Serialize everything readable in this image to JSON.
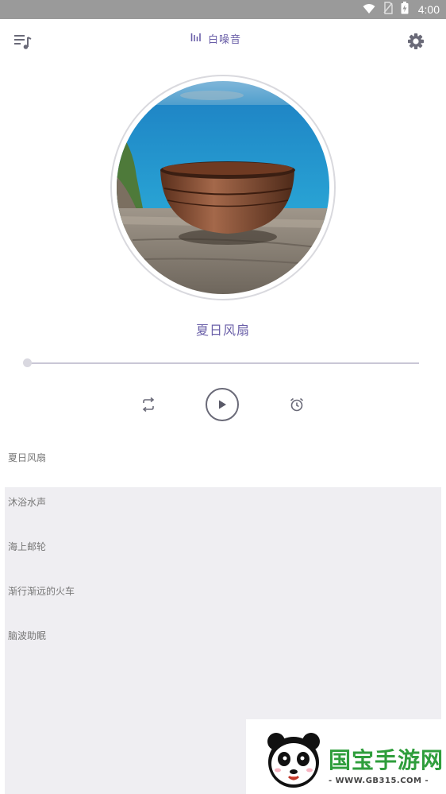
{
  "status_bar": {
    "time": "4:00"
  },
  "toolbar": {
    "title": "白噪音"
  },
  "now_playing": {
    "title": "夏日风扇",
    "progress": 0.0
  },
  "playlist": {
    "items": [
      {
        "label": "夏日风扇"
      },
      {
        "label": "沐浴水声"
      },
      {
        "label": "海上邮轮"
      },
      {
        "label": "渐行渐远的火车"
      },
      {
        "label": "脑波助眠"
      }
    ]
  },
  "watermark": {
    "title": "国宝手游网",
    "subtitle": "- WWW.GB315.COM -"
  },
  "colors": {
    "accent": "#6a5fa8",
    "panel": "#efeef2",
    "status_bar": "#9a9a9a"
  }
}
